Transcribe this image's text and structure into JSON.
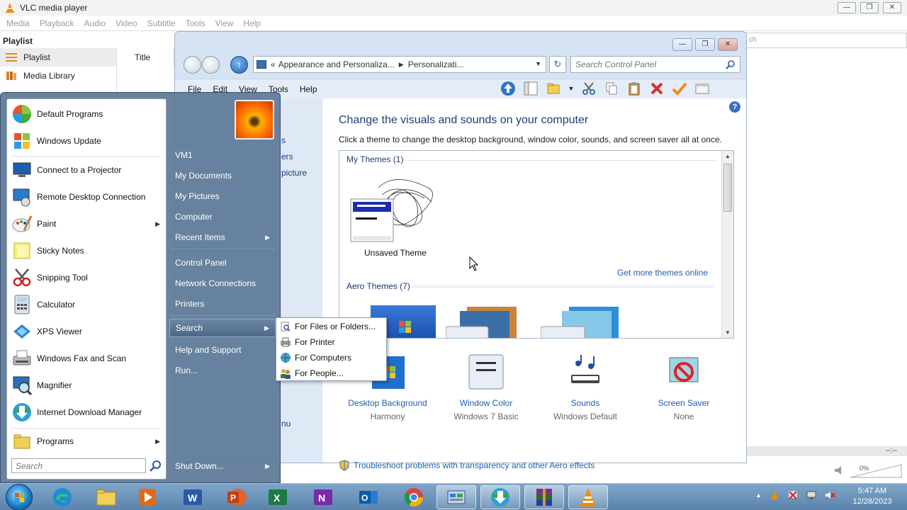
{
  "vlc": {
    "title": "VLC media player",
    "menu": [
      "Media",
      "Playback",
      "Audio",
      "Video",
      "Subtitle",
      "Tools",
      "View",
      "Help"
    ],
    "playlist_heading": "Playlist",
    "sidebar": [
      {
        "label": "Playlist",
        "icon": "playlist-icon"
      },
      {
        "label": "Media Library",
        "icon": "media-library-icon"
      }
    ],
    "column_title": "Title",
    "search_fragment": "ch",
    "time_display": "--:--",
    "volume": "0%"
  },
  "control_panel": {
    "breadcrumb": [
      "Appearance and Personaliza...",
      "Personalizati..."
    ],
    "search_placeholder": "Search Control Panel",
    "menu": [
      "File",
      "Edit",
      "View",
      "Tools",
      "Help"
    ],
    "left_fragments": [
      "s",
      "ers",
      "picture",
      "nu"
    ],
    "heading": "Change the visuals and sounds on your computer",
    "subheading": "Click a theme to change the desktop background, window color, sounds, and screen saver all at once.",
    "my_themes_label": "My Themes (1)",
    "unsaved_theme": "Unsaved Theme",
    "get_more": "Get more themes online",
    "aero_themes_label": "Aero Themes (7)",
    "settings": [
      {
        "label": "Desktop Background",
        "value": "Harmony"
      },
      {
        "label": "Window Color",
        "value": "Windows 7 Basic"
      },
      {
        "label": "Sounds",
        "value": "Windows Default"
      },
      {
        "label": "Screen Saver",
        "value": "None"
      }
    ],
    "troubleshoot": "Troubleshoot problems with transparency and other Aero effects"
  },
  "start_menu": {
    "pinned": [
      {
        "label": "Default Programs",
        "icon": "default-programs-icon"
      },
      {
        "label": "Windows Update",
        "icon": "windows-update-icon"
      }
    ],
    "recent": [
      {
        "label": "Connect to a Projector",
        "icon": "projector-icon"
      },
      {
        "label": "Remote Desktop Connection",
        "icon": "remote-desktop-icon"
      },
      {
        "label": "Paint",
        "icon": "paint-icon"
      },
      {
        "label": "Sticky Notes",
        "icon": "sticky-notes-icon"
      },
      {
        "label": "Snipping Tool",
        "icon": "snipping-tool-icon"
      },
      {
        "label": "Calculator",
        "icon": "calculator-icon"
      },
      {
        "label": "XPS Viewer",
        "icon": "xps-viewer-icon"
      },
      {
        "label": "Windows Fax and Scan",
        "icon": "fax-scan-icon"
      },
      {
        "label": "Magnifier",
        "icon": "magnifier-icon"
      },
      {
        "label": "Internet Download Manager",
        "icon": "idm-icon"
      }
    ],
    "programs": "Programs",
    "search_placeholder": "Search",
    "right": {
      "user": "VM1",
      "my_documents": "My Documents",
      "my_pictures": "My Pictures",
      "computer": "Computer",
      "recent_items": "Recent Items",
      "control_panel": "Control Panel",
      "network_connections": "Network Connections",
      "printers": "Printers",
      "search": "Search",
      "help_support": "Help and Support",
      "run": "Run...",
      "shut_down": "Shut Down..."
    },
    "search_flyout": [
      {
        "label": "For Files or Folders...",
        "icon": "files-folders-icon"
      },
      {
        "label": "For Printer",
        "icon": "printer-icon"
      },
      {
        "label": "For Computers",
        "icon": "computers-icon"
      },
      {
        "label": "For People...",
        "icon": "people-icon"
      }
    ]
  },
  "taskbar": {
    "apps": [
      "Microsoft Edge",
      "File Explorer",
      "Media Player",
      "Word",
      "PowerPoint",
      "Excel",
      "OneNote",
      "Outlook",
      "Chrome",
      "Control Panel",
      "Internet Download Manager",
      "WinRAR",
      "VLC"
    ],
    "time": "5:47 AM",
    "date": "12/28/2023"
  },
  "colors": {
    "link": "#1e5fb0",
    "heading": "#1e3e7a",
    "start_bg": "#5c7896",
    "taskbar": "#6b93bb"
  }
}
